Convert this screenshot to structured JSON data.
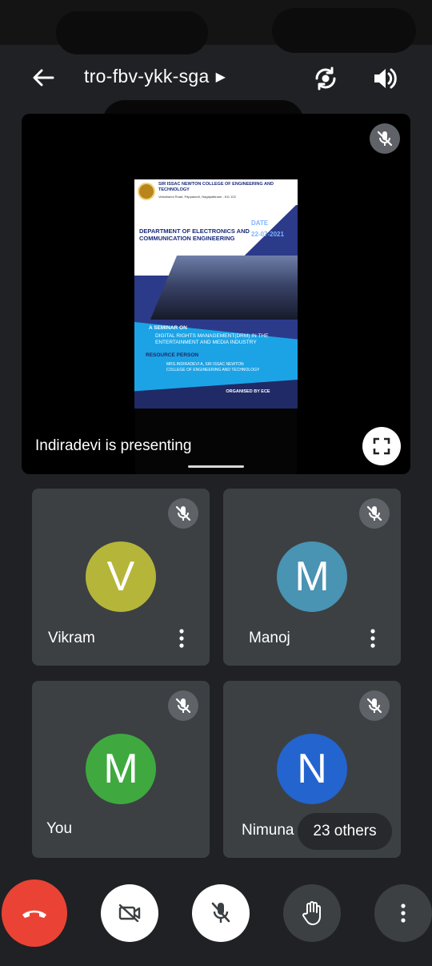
{
  "header": {
    "meeting_code": "tro-fbv-ykk-sga"
  },
  "presentation": {
    "presenting_label": "Indiradevi is presenting",
    "poster": {
      "college": "SIR ISSAC NEWTON COLLEGE OF ENGINEERING AND TECHNOLOGY",
      "address": "Velankanni Road, Pappakovil, Nagapattinam - 611 102",
      "department": "DEPARTMENT OF ELECTRONICS AND COMMUNICATION ENGINEERING",
      "date_label": "DATE",
      "date_value": "22-07-2021",
      "seminar_on": "A SEMINAR ON",
      "topic": "DIGITAL RIGHTS MANAGEMENT(DRM) IN THE ENTERTAINMENT AND MEDIA INDUSTRY",
      "resource_label": "RESOURCE PERSON",
      "resource_person": "MRS.INDIRADEVI A, SIR ISSAC NEWTON COLLEGE OF ENGINEERING AND TECHNOLOGY",
      "organised_by": "ORGANISED BY ECE"
    }
  },
  "participants": [
    {
      "name": "Vikram",
      "initial": "V",
      "color": "#b5b53a"
    },
    {
      "name": "Manoj",
      "initial": "M",
      "color": "#4993b3"
    },
    {
      "name": "You",
      "initial": "M",
      "color": "#3fa93f"
    },
    {
      "name": "Nimuna",
      "initial": "N",
      "color": "#2364cf"
    }
  ],
  "others_count": "23 others",
  "colors": {
    "background": "#202124",
    "tile": "#3c4043",
    "end_call": "#ea4335"
  }
}
